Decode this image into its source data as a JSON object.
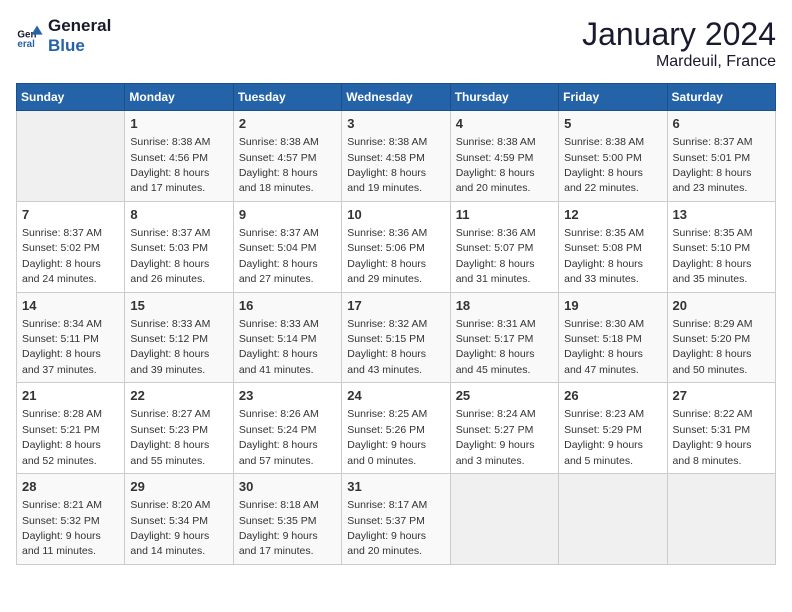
{
  "header": {
    "logo_line1": "General",
    "logo_line2": "Blue",
    "month": "January 2024",
    "location": "Mardeuil, France"
  },
  "days_of_week": [
    "Sunday",
    "Monday",
    "Tuesday",
    "Wednesday",
    "Thursday",
    "Friday",
    "Saturday"
  ],
  "weeks": [
    [
      {
        "day": "",
        "info": ""
      },
      {
        "day": "1",
        "info": "Sunrise: 8:38 AM\nSunset: 4:56 PM\nDaylight: 8 hours\nand 17 minutes."
      },
      {
        "day": "2",
        "info": "Sunrise: 8:38 AM\nSunset: 4:57 PM\nDaylight: 8 hours\nand 18 minutes."
      },
      {
        "day": "3",
        "info": "Sunrise: 8:38 AM\nSunset: 4:58 PM\nDaylight: 8 hours\nand 19 minutes."
      },
      {
        "day": "4",
        "info": "Sunrise: 8:38 AM\nSunset: 4:59 PM\nDaylight: 8 hours\nand 20 minutes."
      },
      {
        "day": "5",
        "info": "Sunrise: 8:38 AM\nSunset: 5:00 PM\nDaylight: 8 hours\nand 22 minutes."
      },
      {
        "day": "6",
        "info": "Sunrise: 8:37 AM\nSunset: 5:01 PM\nDaylight: 8 hours\nand 23 minutes."
      }
    ],
    [
      {
        "day": "7",
        "info": "Sunrise: 8:37 AM\nSunset: 5:02 PM\nDaylight: 8 hours\nand 24 minutes."
      },
      {
        "day": "8",
        "info": "Sunrise: 8:37 AM\nSunset: 5:03 PM\nDaylight: 8 hours\nand 26 minutes."
      },
      {
        "day": "9",
        "info": "Sunrise: 8:37 AM\nSunset: 5:04 PM\nDaylight: 8 hours\nand 27 minutes."
      },
      {
        "day": "10",
        "info": "Sunrise: 8:36 AM\nSunset: 5:06 PM\nDaylight: 8 hours\nand 29 minutes."
      },
      {
        "day": "11",
        "info": "Sunrise: 8:36 AM\nSunset: 5:07 PM\nDaylight: 8 hours\nand 31 minutes."
      },
      {
        "day": "12",
        "info": "Sunrise: 8:35 AM\nSunset: 5:08 PM\nDaylight: 8 hours\nand 33 minutes."
      },
      {
        "day": "13",
        "info": "Sunrise: 8:35 AM\nSunset: 5:10 PM\nDaylight: 8 hours\nand 35 minutes."
      }
    ],
    [
      {
        "day": "14",
        "info": "Sunrise: 8:34 AM\nSunset: 5:11 PM\nDaylight: 8 hours\nand 37 minutes."
      },
      {
        "day": "15",
        "info": "Sunrise: 8:33 AM\nSunset: 5:12 PM\nDaylight: 8 hours\nand 39 minutes."
      },
      {
        "day": "16",
        "info": "Sunrise: 8:33 AM\nSunset: 5:14 PM\nDaylight: 8 hours\nand 41 minutes."
      },
      {
        "day": "17",
        "info": "Sunrise: 8:32 AM\nSunset: 5:15 PM\nDaylight: 8 hours\nand 43 minutes."
      },
      {
        "day": "18",
        "info": "Sunrise: 8:31 AM\nSunset: 5:17 PM\nDaylight: 8 hours\nand 45 minutes."
      },
      {
        "day": "19",
        "info": "Sunrise: 8:30 AM\nSunset: 5:18 PM\nDaylight: 8 hours\nand 47 minutes."
      },
      {
        "day": "20",
        "info": "Sunrise: 8:29 AM\nSunset: 5:20 PM\nDaylight: 8 hours\nand 50 minutes."
      }
    ],
    [
      {
        "day": "21",
        "info": "Sunrise: 8:28 AM\nSunset: 5:21 PM\nDaylight: 8 hours\nand 52 minutes."
      },
      {
        "day": "22",
        "info": "Sunrise: 8:27 AM\nSunset: 5:23 PM\nDaylight: 8 hours\nand 55 minutes."
      },
      {
        "day": "23",
        "info": "Sunrise: 8:26 AM\nSunset: 5:24 PM\nDaylight: 8 hours\nand 57 minutes."
      },
      {
        "day": "24",
        "info": "Sunrise: 8:25 AM\nSunset: 5:26 PM\nDaylight: 9 hours\nand 0 minutes."
      },
      {
        "day": "25",
        "info": "Sunrise: 8:24 AM\nSunset: 5:27 PM\nDaylight: 9 hours\nand 3 minutes."
      },
      {
        "day": "26",
        "info": "Sunrise: 8:23 AM\nSunset: 5:29 PM\nDaylight: 9 hours\nand 5 minutes."
      },
      {
        "day": "27",
        "info": "Sunrise: 8:22 AM\nSunset: 5:31 PM\nDaylight: 9 hours\nand 8 minutes."
      }
    ],
    [
      {
        "day": "28",
        "info": "Sunrise: 8:21 AM\nSunset: 5:32 PM\nDaylight: 9 hours\nand 11 minutes."
      },
      {
        "day": "29",
        "info": "Sunrise: 8:20 AM\nSunset: 5:34 PM\nDaylight: 9 hours\nand 14 minutes."
      },
      {
        "day": "30",
        "info": "Sunrise: 8:18 AM\nSunset: 5:35 PM\nDaylight: 9 hours\nand 17 minutes."
      },
      {
        "day": "31",
        "info": "Sunrise: 8:17 AM\nSunset: 5:37 PM\nDaylight: 9 hours\nand 20 minutes."
      },
      {
        "day": "",
        "info": ""
      },
      {
        "day": "",
        "info": ""
      },
      {
        "day": "",
        "info": ""
      }
    ]
  ]
}
